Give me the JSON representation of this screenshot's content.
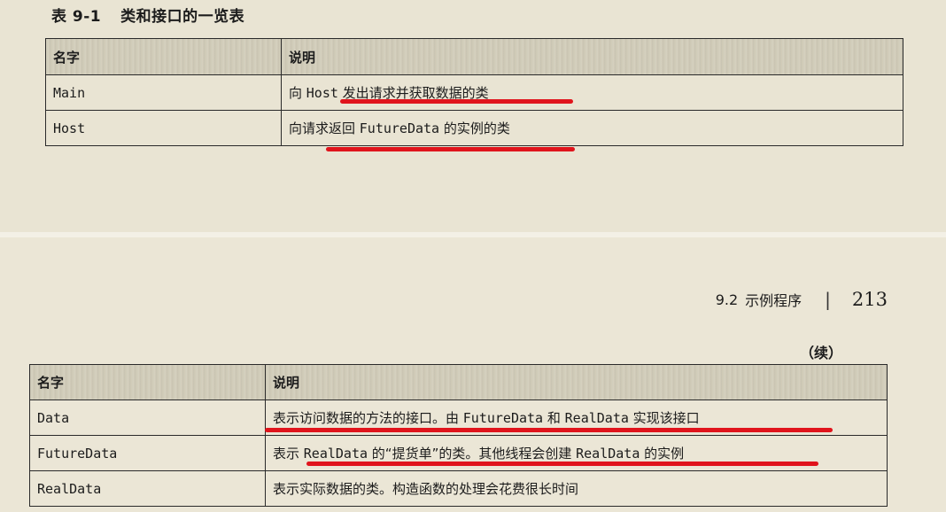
{
  "top_table": {
    "caption_number": "表 9-1",
    "caption_title": "类和接口的一览表",
    "header": {
      "name": "名字",
      "desc": "说明"
    },
    "rows": [
      {
        "name": "Main",
        "desc": [
          {
            "text": "向 ",
            "mono": false
          },
          {
            "text": "Host",
            "mono": true
          },
          {
            "text": " 发出请求并获取数据的类",
            "mono": false
          }
        ]
      },
      {
        "name": "Host",
        "desc": [
          {
            "text": "向请求返回 ",
            "mono": false
          },
          {
            "text": "FutureData",
            "mono": true
          },
          {
            "text": " 的实例的类",
            "mono": false
          }
        ]
      }
    ]
  },
  "page_header": {
    "section_number": "9.2",
    "section_title": "示例程序",
    "separator": "|",
    "page_number": "213"
  },
  "continued_label": "（续）",
  "bottom_table": {
    "header": {
      "name": "名字",
      "desc": "说明"
    },
    "rows": [
      {
        "name": "Data",
        "desc": [
          {
            "text": "表示访问数据的方法的接口。由 ",
            "mono": false
          },
          {
            "text": "FutureData",
            "mono": true
          },
          {
            "text": " 和 ",
            "mono": false
          },
          {
            "text": "RealData",
            "mono": true
          },
          {
            "text": " 实现该接口",
            "mono": false
          }
        ]
      },
      {
        "name": "FutureData",
        "desc": [
          {
            "text": "表示 ",
            "mono": false
          },
          {
            "text": "RealData",
            "mono": true
          },
          {
            "text": " 的“提货单”的类。其他线程会创建 ",
            "mono": false
          },
          {
            "text": "RealData",
            "mono": true
          },
          {
            "text": " 的实例",
            "mono": false
          }
        ]
      },
      {
        "name": "RealData",
        "desc": [
          {
            "text": "表示实际数据的类。构造函数的处理会花费很长时间",
            "mono": false
          }
        ]
      }
    ]
  },
  "colors": {
    "paper": "#e9e4d3",
    "annotation_red": "#e0141c",
    "ink": "#1c1c1c"
  }
}
